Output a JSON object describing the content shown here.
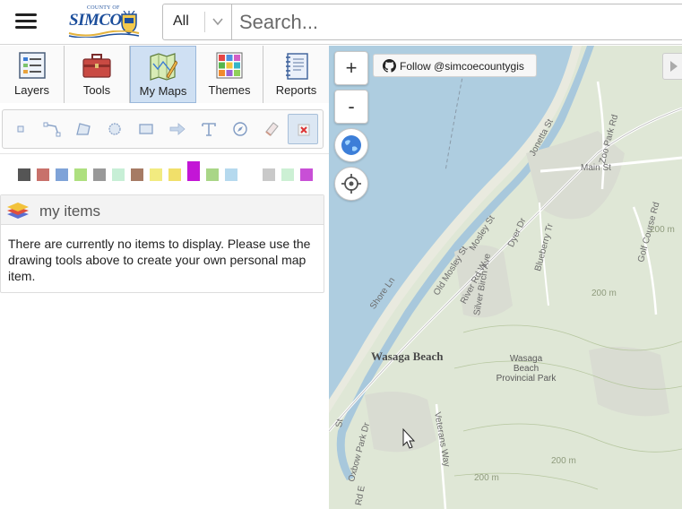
{
  "header": {
    "menu_icon": "hamburger-icon",
    "logo": {
      "county_text": "COUNTY OF",
      "name_text": "SIMCOE"
    },
    "search": {
      "filter_value": "All",
      "placeholder": "Search..."
    }
  },
  "tabs": [
    {
      "label": "Layers",
      "icon": "layers-list-icon",
      "active": false
    },
    {
      "label": "Tools",
      "icon": "toolbox-icon",
      "active": false
    },
    {
      "label": "My Maps",
      "icon": "map-pencil-icon",
      "active": true
    },
    {
      "label": "Themes",
      "icon": "themes-grid-icon",
      "active": false
    },
    {
      "label": "Reports",
      "icon": "report-notebook-icon",
      "active": false
    }
  ],
  "drawing_tools": [
    "point-tool-icon",
    "line-tool-icon",
    "polygon-tool-icon",
    "circle-tool-icon",
    "rectangle-tool-icon",
    "arrow-tool-icon",
    "text-tool-icon",
    "measure-tool-icon",
    "eraser-tool-icon",
    "delete-tool-icon"
  ],
  "palette": {
    "colors": [
      "#555555",
      "#c8716b",
      "#7fa3d8",
      "#aee07f",
      "#999999",
      "#c7efd6",
      "#a67b64",
      "#f2eb80",
      "#f1e06a",
      "#c316d6",
      "#a9d687",
      "#b5d9ee",
      "#c9c9c9",
      "#ccf0d4",
      "#c84fd6"
    ],
    "selected": "#c316d6"
  },
  "my_items": {
    "title": "my items",
    "message": "There are currently no items to display. Please use the drawing tools above to create your own personal map item."
  },
  "map": {
    "zoom_in": "+",
    "zoom_out": "-",
    "follow_button": "Follow @simcoecountygis",
    "labels": {
      "town": "Wasaga Beach",
      "park": [
        "Wasaga",
        "Beach",
        "Provincial Park"
      ],
      "streets": [
        "Shore Ln",
        "Old Mosley St",
        "Mosley St",
        "River Rd W",
        "Dyer Dr",
        "Silver Birch Ave",
        "Blueberry Tr",
        "Main St",
        "Zoo Park Rd",
        "Jonetta St",
        "Golf Course Rd",
        "Oxbow Park Dr",
        "Veterans Way",
        "Rd E",
        "St"
      ],
      "contours": [
        "200 m",
        "200 m",
        "200 m",
        "200 m"
      ]
    },
    "colors": {
      "water": "#aecde0",
      "land": "#dfe7d6",
      "river": "#a8c8dc",
      "road": "#ffffff"
    }
  }
}
